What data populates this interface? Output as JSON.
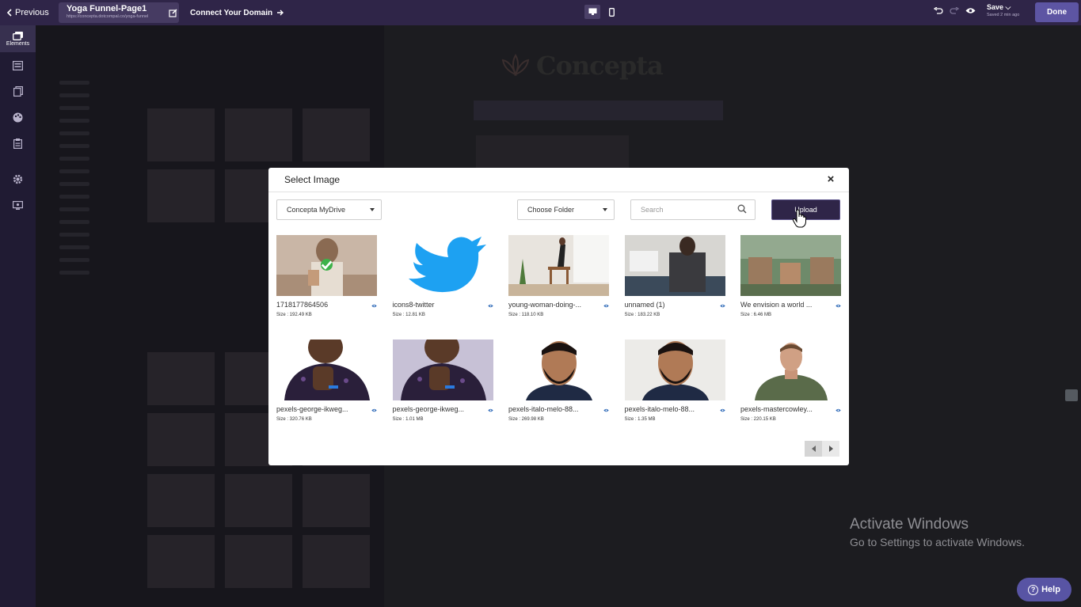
{
  "topbar": {
    "previous_label": "Previous",
    "page_title": "Yoga Funnel-Page1",
    "page_url": "https://concepta.dotcompal.co/yoga-funnel",
    "connect_domain_label": "Connect Your Domain",
    "save_label": "Save",
    "saved_status": "Saved 2 min ago",
    "done_label": "Done"
  },
  "rail": {
    "elements_label": "Elements"
  },
  "canvas": {
    "logo_text": "Concepta"
  },
  "modal": {
    "title": "Select Image",
    "drive_select": "Concepta MyDrive",
    "folder_select": "Choose Folder",
    "search_placeholder": "Search",
    "upload_label": "Upload",
    "images": [
      {
        "name": "1718177864506",
        "size": "Size : 192.49 KB",
        "selected": true
      },
      {
        "name": "icons8-twitter",
        "size": "Size : 12.81 KB"
      },
      {
        "name": "young-woman-doing-...",
        "size": "Size : 118.10 KB"
      },
      {
        "name": "unnamed (1)",
        "size": "Size : 183.22 KB"
      },
      {
        "name": "We envision a world ...",
        "size": "Size : 6.46 MB"
      },
      {
        "name": "pexels-george-ikweg...",
        "size": "Size : 320.76 KB"
      },
      {
        "name": "pexels-george-ikweg...",
        "size": "Size : 1.01 MB"
      },
      {
        "name": "pexels-italo-melo-88...",
        "size": "Size : 269.98 KB"
      },
      {
        "name": "pexels-italo-melo-88...",
        "size": "Size : 1.35 MB"
      },
      {
        "name": "pexels-mastercowley...",
        "size": "Size : 220.15 KB"
      }
    ]
  },
  "watermark": {
    "title": "Activate Windows",
    "subtitle": "Go to Settings to activate Windows."
  },
  "help": {
    "label": "Help"
  }
}
